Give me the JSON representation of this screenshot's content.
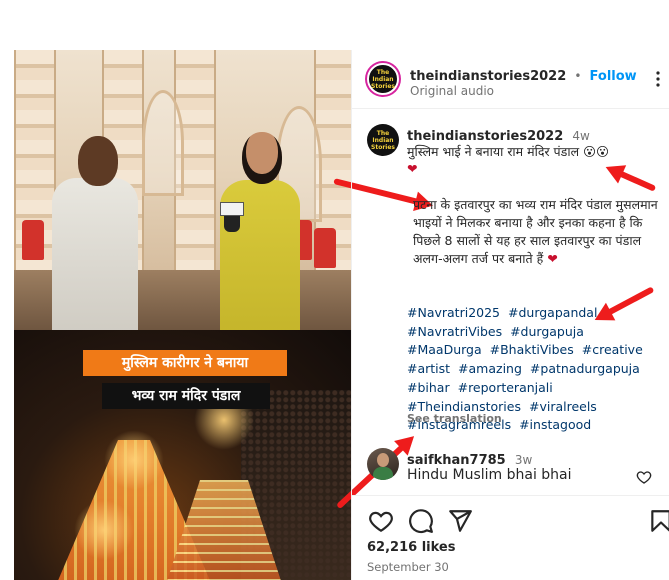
{
  "post": {
    "author": "theindianstories2022",
    "separator": "•",
    "follow_label": "Follow",
    "audio": "Original audio",
    "avatar_text": "The Indian Stories"
  },
  "media": {
    "banner_line1": "मुस्लिम कारीगर ने बनाया",
    "banner_line2": "भव्य राम मंदिर पंडाल"
  },
  "caption": {
    "author": "theindianstories2022",
    "age": "4w",
    "line1": "मुस्लिम भाई ने बनाया राम मंदिर पंडाल 😮😮",
    "heart": "❤",
    "body": "पटना के इतवारपुर का भव्य राम मंदिर पंडाल मुसलमान भाइयों ने मिलकर बनाया है और इनका कहना है कि पिछले 8 सालों से यह हर साल इतवारपुर का पंडाल अलग-अलग तर्ज पर बनाते हैं",
    "body_heart": "❤",
    "hashtags": [
      "#Navratri2025",
      "#durgapandal",
      "#NavratriVibes",
      "#durgapuja",
      "#MaaDurga",
      "#BhaktiVibes",
      "#creative",
      "#artist",
      "#amazing",
      "#patnadurgapuja",
      "#bihar",
      "#reporteranjali",
      "#Theindianstories",
      "#viralreels",
      "#instagramreels",
      "#instagood"
    ],
    "see_translation": "See translation"
  },
  "comment": {
    "author": "saifkhan7785",
    "age": "3w",
    "text": "Hindu Muslim bhai bhai"
  },
  "stats": {
    "likes": "62,216 likes",
    "date": "September 30"
  },
  "colors": {
    "accent": "#0095f6",
    "hashtag": "#00376b",
    "arrow": "#ee1c1c",
    "banner_orange": "#f07a17"
  },
  "icons": [
    "more-options-icon",
    "heart-icon",
    "comment-icon",
    "share-icon",
    "bookmark-icon",
    "comment-like-icon"
  ]
}
